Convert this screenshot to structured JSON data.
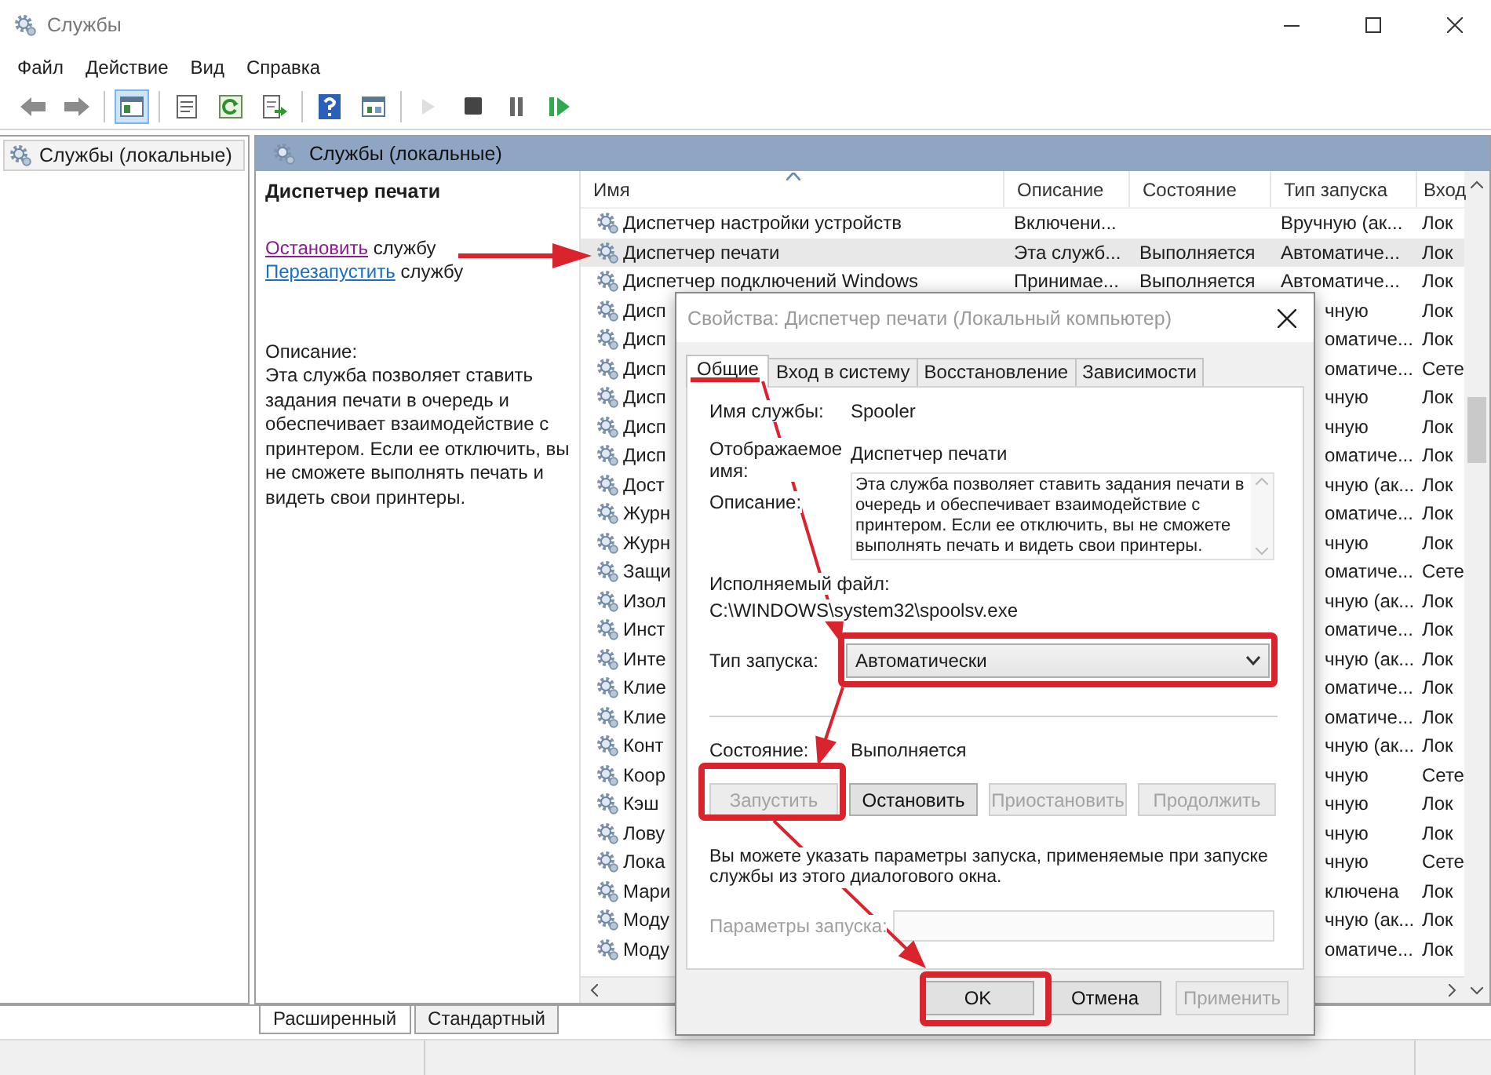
{
  "window": {
    "title": "Службы"
  },
  "menu": [
    "Файл",
    "Действие",
    "Вид",
    "Справка"
  ],
  "toolbar_groups": [
    {
      "items": [
        {
          "kind": "back",
          "pressed": false,
          "disabled": false
        },
        {
          "kind": "forward",
          "pressed": false,
          "disabled": false
        }
      ]
    },
    {
      "items": [
        {
          "kind": "tree",
          "pressed": true,
          "disabled": false
        }
      ]
    },
    {
      "items": [
        {
          "kind": "properties",
          "pressed": false,
          "disabled": false
        },
        {
          "kind": "refresh",
          "pressed": false,
          "disabled": false
        },
        {
          "kind": "export",
          "pressed": false,
          "disabled": false
        }
      ]
    },
    {
      "items": [
        {
          "kind": "help",
          "pressed": false,
          "disabled": false
        },
        {
          "kind": "view",
          "pressed": false,
          "disabled": false
        }
      ]
    },
    {
      "items": [
        {
          "kind": "play",
          "pressed": false,
          "disabled": true
        },
        {
          "kind": "stop",
          "pressed": false,
          "disabled": false
        },
        {
          "kind": "pause",
          "pressed": false,
          "disabled": false
        },
        {
          "kind": "resume",
          "pressed": false,
          "disabled": false
        }
      ]
    }
  ],
  "tree": {
    "items": [
      {
        "label": "Службы (локальные)",
        "selected": true
      }
    ]
  },
  "panel": {
    "title": "Службы (локальные)"
  },
  "details": {
    "service_name": "Диспетчер печати",
    "actions": [
      {
        "link": "Остановить",
        "text": "службу",
        "visited": true
      },
      {
        "link": "Перезапустить",
        "text": "службу",
        "visited": false
      }
    ],
    "description_label": "Описание:",
    "description": "Эта служба позволяет ставить задания печати в очередь и обеспечивает взаимодействие с принтером. Если ее отключить, вы не сможете выполнять печать и видеть свои принтеры."
  },
  "table": {
    "columns": [
      {
        "label": "Имя",
        "sorted": true
      },
      {
        "label": "Описание",
        "sorted": false
      },
      {
        "label": "Состояние",
        "sorted": false
      },
      {
        "label": "Тип запуска",
        "sorted": false
      },
      {
        "label": "Вход",
        "sorted": false
      }
    ],
    "rows": [
      {
        "kind": "full",
        "name": "Диспетчер настройки устройств",
        "description": "Включени...",
        "startup": "Вручную (ак...",
        "logon": "Лок",
        "selected": false
      },
      {
        "kind": "full",
        "name": "Диспетчер печати",
        "description": "Эта служб...",
        "status": "Выполняется",
        "startup": "Автоматиче...",
        "logon": "Лок",
        "selected": true
      },
      {
        "kind": "full",
        "name": "Диспетчер подключений Windows",
        "description": "Принимае...",
        "status": "Выполняется",
        "startup": "Автоматиче...",
        "logon": "Лок",
        "selected": false
      },
      {
        "kind": "partial",
        "name": "Дисп",
        "startup": "чную",
        "logon": "Лок",
        "selected": false
      },
      {
        "kind": "partial",
        "name": "Дисп",
        "startup": "оматиче...",
        "logon": "Лок",
        "selected": false
      },
      {
        "kind": "partial",
        "name": "Дисп",
        "startup": "оматиче...",
        "logon": "Сете",
        "selected": false
      },
      {
        "kind": "partial",
        "name": "Дисп",
        "startup": "чную",
        "logon": "Лок",
        "selected": false
      },
      {
        "kind": "partial",
        "name": "Дисп",
        "startup": "чную",
        "logon": "Лок",
        "selected": false
      },
      {
        "kind": "partial",
        "name": "Дисп",
        "startup": "оматиче...",
        "logon": "Лок",
        "selected": false
      },
      {
        "kind": "partial",
        "name": "Дост",
        "startup": "чную (ак...",
        "logon": "Лок",
        "selected": false
      },
      {
        "kind": "partial",
        "name": "Журн",
        "startup": "оматиче...",
        "logon": "Лок",
        "selected": false
      },
      {
        "kind": "partial",
        "name": "Журн",
        "startup": "чную",
        "logon": "Лок",
        "selected": false
      },
      {
        "kind": "partial",
        "name": "Защи",
        "startup": "оматиче...",
        "logon": "Сете",
        "selected": false
      },
      {
        "kind": "partial",
        "name": "Изол",
        "startup": "чную (ак...",
        "logon": "Лок",
        "selected": false
      },
      {
        "kind": "partial",
        "name": "Инст",
        "startup": "оматиче...",
        "logon": "Лок",
        "selected": false
      },
      {
        "kind": "partial",
        "name": "Инте",
        "startup": "чную (ак...",
        "logon": "Лок",
        "selected": false
      },
      {
        "kind": "partial",
        "name": "Клие",
        "startup": "оматиче...",
        "logon": "Лок",
        "selected": false
      },
      {
        "kind": "partial",
        "name": "Клие",
        "startup": "оматиче...",
        "logon": "Лок",
        "selected": false
      },
      {
        "kind": "partial",
        "name": "Конт",
        "startup": "чную (ак...",
        "logon": "Лок",
        "selected": false
      },
      {
        "kind": "partial",
        "name": "Коор",
        "startup": "чную",
        "logon": "Сете",
        "selected": false
      },
      {
        "kind": "partial",
        "name": "Кэш",
        "startup": "чную",
        "logon": "Лок",
        "selected": false
      },
      {
        "kind": "partial",
        "name": "Лову",
        "startup": "чную",
        "logon": "Лок",
        "selected": false
      },
      {
        "kind": "partial",
        "name": "Лока",
        "startup": "чную",
        "logon": "Сете",
        "selected": false
      },
      {
        "kind": "partial",
        "name": "Мари",
        "startup": "ключена",
        "logon": "Лок",
        "selected": false
      },
      {
        "kind": "partial",
        "name": "Моду",
        "startup": "чную (ак...",
        "logon": "Лок",
        "selected": false
      },
      {
        "kind": "partial",
        "name": "Моду",
        "startup": "оматиче...",
        "logon": "Лок",
        "selected": false
      }
    ]
  },
  "view_tabs": [
    {
      "label": "Расширенный",
      "selected": true
    },
    {
      "label": "Стандартный",
      "selected": false
    }
  ],
  "dialog": {
    "title": "Свойства: Диспетчер печати (Локальный компьютер)",
    "tabs": [
      {
        "label": "Общие",
        "selected": true
      },
      {
        "label": "Вход в систему",
        "selected": false
      },
      {
        "label": "Восстановление",
        "selected": false
      },
      {
        "label": "Зависимости",
        "selected": false
      }
    ],
    "service_name_label": "Имя службы:",
    "service_name": "Spooler",
    "display_name_label": "Отображаемое имя:",
    "display_name": "Диспетчер печати",
    "description_label": "Описание:",
    "description": "Эта служба позволяет ставить задания печати в очередь и обеспечивает взаимодействие с принтером. Если ее отключить, вы не сможете выполнять печать и видеть свои принтеры.",
    "executable_label": "Исполняемый файл:",
    "executable": "C:\\WINDOWS\\system32\\spoolsv.exe",
    "startup_label": "Тип запуска:",
    "startup_value": "Автоматически",
    "status_label": "Состояние:",
    "status": "Выполняется",
    "service_buttons": [
      {
        "label": "Запустить",
        "disabled": true
      },
      {
        "label": "Остановить",
        "disabled": false
      },
      {
        "label": "Приостановить",
        "disabled": true
      },
      {
        "label": "Продолжить",
        "disabled": true
      }
    ],
    "hint": "Вы можете указать параметры запуска, применяемые при запуске службы из этого диалогового окна.",
    "params": {
      "label": "Параметры запуска:",
      "disabled": true
    },
    "buttons": [
      {
        "label": "OK",
        "disabled": false
      },
      {
        "label": "Отмена",
        "disabled": false
      },
      {
        "label": "Применить",
        "disabled": true
      }
    ]
  }
}
